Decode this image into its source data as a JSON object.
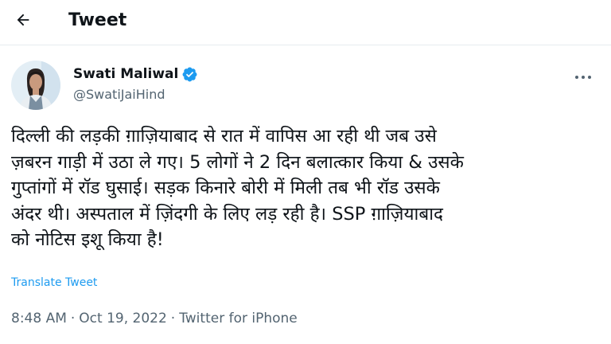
{
  "header": {
    "title": "Tweet",
    "back_icon": "arrow-left-icon"
  },
  "tweet": {
    "author_name": "Swati Maliwal",
    "verified_icon": "verified-badge-icon",
    "handle": "@SwatiJaiHind",
    "more_icon": "more-horizontal-icon",
    "text": "दिल्ली की लड़की ग़ाज़ियाबाद से रात में वापिस आ रही थी जब उसे\nज़बरन गाड़ी में उठा ले गए। 5 लोगों ने 2 दिन बलात्कार किया & उसके\nगुप्तांगों में रॉड घुसाई। सड़क किनारे बोरी में मिली तब भी रॉड उसके\nअंदर थी। अस्पताल में ज़िंदगी के लिए लड़ रही है। SSP ग़ाज़ियाबाद\nको नोटिस इशू किया है!",
    "translate_label": "Translate Tweet",
    "time": "8:48 AM",
    "separator": "·",
    "date": "Oct 19, 2022",
    "source": "Twitter for iPhone"
  },
  "colors": {
    "accent": "#1d9bf0",
    "text": "#0f1419",
    "secondary": "#536471"
  }
}
